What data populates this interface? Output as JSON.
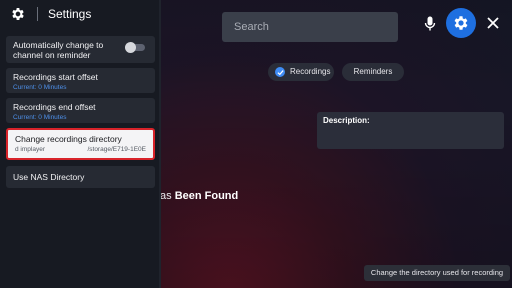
{
  "search": {
    "placeholder": "Search"
  },
  "tabs": [
    {
      "label": "Recordings",
      "selected": true
    },
    {
      "label": "Reminders",
      "selected": false
    }
  ],
  "description": {
    "label": "Description:"
  },
  "center_message": {
    "prefix": "as ",
    "emphasis": "Been Found"
  },
  "tooltip": {
    "text": "Change the directory used for recording"
  },
  "settings": {
    "title": "Settings",
    "items": [
      {
        "title": "Automatically change to channel on reminder",
        "toggle_on": false
      },
      {
        "title": "Recordings start offset",
        "subtitle": "Current: 0 Minutes"
      },
      {
        "title": "Recordings end offset",
        "subtitle": "Current: 0 Minutes"
      },
      {
        "title": "Change recordings directory",
        "path_left": "d implayer",
        "path_right": "/storage/E719-1E0E"
      },
      {
        "title": "Use NAS Directory"
      }
    ]
  },
  "colors": {
    "accent": "#1e6fe0",
    "selection_border": "#d8232a",
    "subtitle_blue": "#4d8fe8"
  },
  "icons": {
    "panel": "gear-icon",
    "mic": "microphone-icon",
    "settings": "gear-icon",
    "close": "close-icon"
  }
}
